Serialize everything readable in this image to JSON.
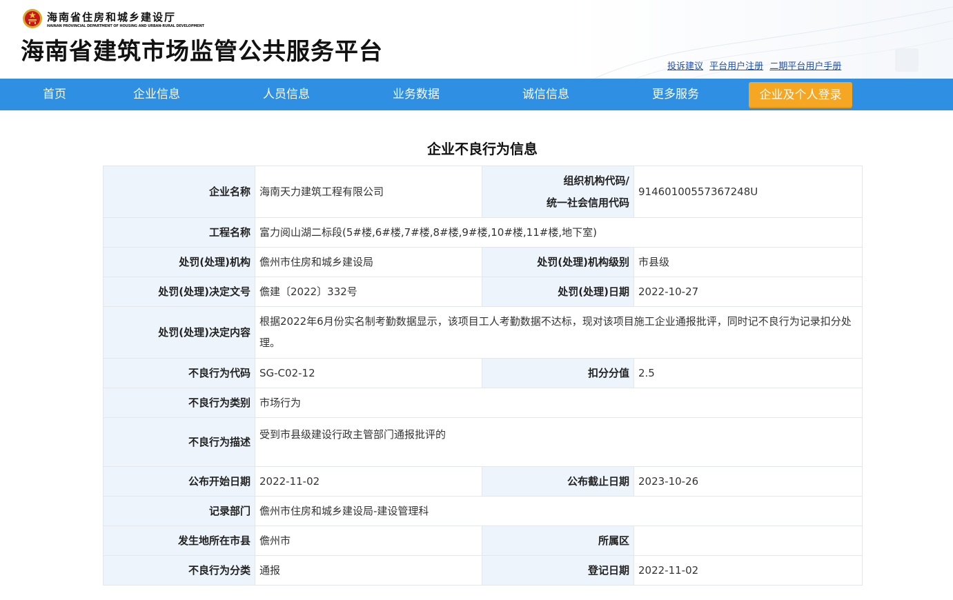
{
  "header": {
    "dept_cn": "海南省住房和城乡建设厅",
    "dept_en": "HAINAN PROVINCIAL DEPARTMENT OF HOUSING AND URBAN-RURAL DEVELOPMENT",
    "platform_title": "海南省建筑市场监管公共服务平台",
    "links": [
      "投诉建议",
      "平台用户注册",
      "二期平台用户手册"
    ]
  },
  "nav": {
    "items": [
      "首页",
      "企业信息",
      "人员信息",
      "业务数据",
      "诚信信息",
      "更多服务"
    ],
    "login_label": "企业及个人登录"
  },
  "page": {
    "heading": "企业不良行为信息"
  },
  "record": {
    "company_name_label": "企业名称",
    "company_name": "海南天力建筑工程有限公司",
    "org_code_label_1": "组织机构代码/",
    "org_code_label_2": "统一社会信用代码",
    "org_code": "91460100557367248U",
    "project_label": "工程名称",
    "project": "富力阅山湖二标段(5#楼,6#楼,7#楼,8#楼,9#楼,10#楼,11#楼,地下室)",
    "agency_label": "处罚(处理)机构",
    "agency": "儋州市住房和城乡建设局",
    "agency_level_label": "处罚(处理)机构级别",
    "agency_level": "市县级",
    "decision_no_label": "处罚(处理)决定文号",
    "decision_no": "儋建〔2022〕332号",
    "decision_date_label": "处罚(处理)日期",
    "decision_date": "2022-10-27",
    "decision_content_label": "处罚(处理)决定内容",
    "decision_content": "根据2022年6月份实名制考勤数据显示，该项目工人考勤数据不达标，现对该项目施工企业通报批评，同时记不良行为记录扣分处理。",
    "behavior_code_label": "不良行为代码",
    "behavior_code": "SG-C02-12",
    "deduction_label": "扣分分值",
    "deduction": "2.5",
    "behavior_type_label": "不良行为类别",
    "behavior_type": "市场行为",
    "behavior_desc_label": "不良行为描述",
    "behavior_desc": "受到市县级建设行政主管部门通报批评的",
    "publish_start_label": "公布开始日期",
    "publish_start": "2022-11-02",
    "publish_end_label": "公布截止日期",
    "publish_end": "2023-10-26",
    "record_dept_label": "记录部门",
    "record_dept": "儋州市住房和城乡建设局-建设管理科",
    "city_label": "发生地所在市县",
    "city": "儋州市",
    "district_label": "所属区",
    "district": "",
    "category_label": "不良行为分类",
    "category": "通报",
    "register_date_label": "登记日期",
    "register_date": "2022-11-02"
  },
  "icons": {
    "emblem": "national-emblem-icon"
  },
  "colors": {
    "nav_bg": "#2e8fe3",
    "login_bg": "#f5a623",
    "label_bg": "#edf4fc",
    "link": "#1e4fb3"
  }
}
